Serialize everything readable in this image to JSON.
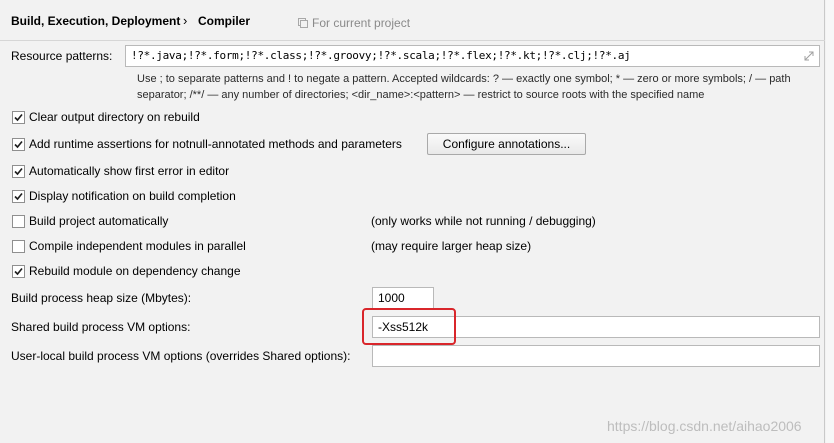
{
  "breadcrumb": {
    "parent": "Build, Execution, Deployment",
    "separator": "›",
    "current": "Compiler",
    "scope": "For current project"
  },
  "resource_patterns": {
    "label": "Resource patterns:",
    "value": "!?*.java;!?*.form;!?*.class;!?*.groovy;!?*.scala;!?*.flex;!?*.kt;!?*.clj;!?*.aj",
    "hint_line1": "Use ; to separate patterns and ! to negate a pattern. Accepted wildcards: ? — exactly one symbol; * — zero or more symbols; / — path",
    "hint_line2": "separator; /**/ — any number of directories; <dir_name>:<pattern> — restrict to source roots with the specified name"
  },
  "options": [
    {
      "label": "Clear output directory on rebuild",
      "checked": true,
      "note": ""
    },
    {
      "label": "Add runtime assertions for notnull-annotated methods and parameters",
      "checked": true,
      "note": ""
    },
    {
      "label": "Automatically show first error in editor",
      "checked": true,
      "note": ""
    },
    {
      "label": "Display notification on build completion",
      "checked": true,
      "note": ""
    },
    {
      "label": "Build project automatically",
      "checked": false,
      "note": "(only works while not running / debugging)"
    },
    {
      "label": "Compile independent modules in parallel",
      "checked": false,
      "note": "(may require larger heap size)"
    },
    {
      "label": "Rebuild module on dependency change",
      "checked": true,
      "note": ""
    }
  ],
  "configure_button": "Configure annotations...",
  "heap": {
    "label": "Build process heap size (Mbytes):",
    "value": "1000"
  },
  "shared_vm": {
    "label": "Shared build process VM options:",
    "value": "-Xss512k"
  },
  "user_vm": {
    "label": "User-local build process VM options (overrides Shared options):",
    "value": ""
  },
  "watermark": "https://blog.csdn.net/aihao2006",
  "colors": {
    "highlight": "#d9262b",
    "background": "#f2f2f2"
  }
}
